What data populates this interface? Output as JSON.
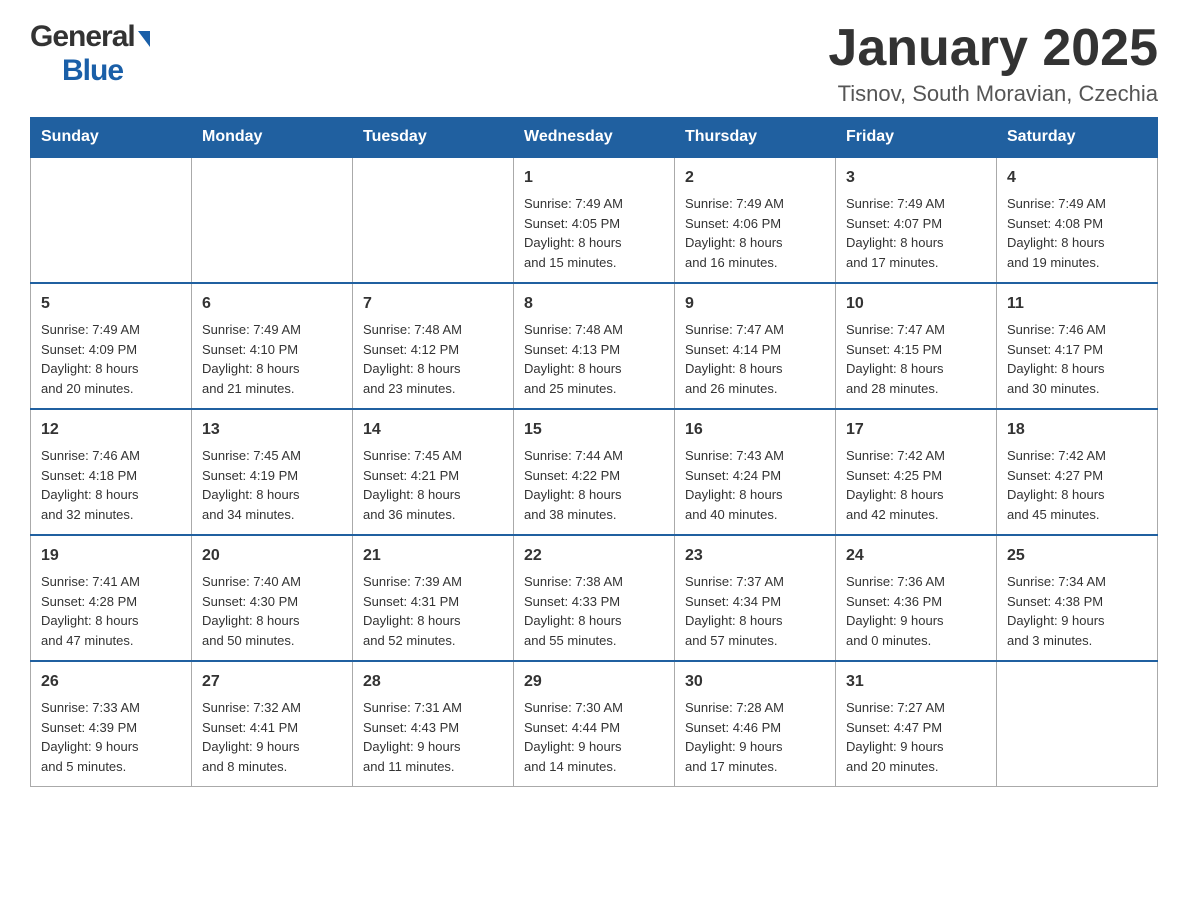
{
  "header": {
    "logo_general": "General",
    "logo_blue": "Blue",
    "title": "January 2025",
    "location": "Tisnov, South Moravian, Czechia"
  },
  "days_of_week": [
    "Sunday",
    "Monday",
    "Tuesday",
    "Wednesday",
    "Thursday",
    "Friday",
    "Saturday"
  ],
  "weeks": [
    [
      {
        "day": "",
        "info": ""
      },
      {
        "day": "",
        "info": ""
      },
      {
        "day": "",
        "info": ""
      },
      {
        "day": "1",
        "info": "Sunrise: 7:49 AM\nSunset: 4:05 PM\nDaylight: 8 hours\nand 15 minutes."
      },
      {
        "day": "2",
        "info": "Sunrise: 7:49 AM\nSunset: 4:06 PM\nDaylight: 8 hours\nand 16 minutes."
      },
      {
        "day": "3",
        "info": "Sunrise: 7:49 AM\nSunset: 4:07 PM\nDaylight: 8 hours\nand 17 minutes."
      },
      {
        "day": "4",
        "info": "Sunrise: 7:49 AM\nSunset: 4:08 PM\nDaylight: 8 hours\nand 19 minutes."
      }
    ],
    [
      {
        "day": "5",
        "info": "Sunrise: 7:49 AM\nSunset: 4:09 PM\nDaylight: 8 hours\nand 20 minutes."
      },
      {
        "day": "6",
        "info": "Sunrise: 7:49 AM\nSunset: 4:10 PM\nDaylight: 8 hours\nand 21 minutes."
      },
      {
        "day": "7",
        "info": "Sunrise: 7:48 AM\nSunset: 4:12 PM\nDaylight: 8 hours\nand 23 minutes."
      },
      {
        "day": "8",
        "info": "Sunrise: 7:48 AM\nSunset: 4:13 PM\nDaylight: 8 hours\nand 25 minutes."
      },
      {
        "day": "9",
        "info": "Sunrise: 7:47 AM\nSunset: 4:14 PM\nDaylight: 8 hours\nand 26 minutes."
      },
      {
        "day": "10",
        "info": "Sunrise: 7:47 AM\nSunset: 4:15 PM\nDaylight: 8 hours\nand 28 minutes."
      },
      {
        "day": "11",
        "info": "Sunrise: 7:46 AM\nSunset: 4:17 PM\nDaylight: 8 hours\nand 30 minutes."
      }
    ],
    [
      {
        "day": "12",
        "info": "Sunrise: 7:46 AM\nSunset: 4:18 PM\nDaylight: 8 hours\nand 32 minutes."
      },
      {
        "day": "13",
        "info": "Sunrise: 7:45 AM\nSunset: 4:19 PM\nDaylight: 8 hours\nand 34 minutes."
      },
      {
        "day": "14",
        "info": "Sunrise: 7:45 AM\nSunset: 4:21 PM\nDaylight: 8 hours\nand 36 minutes."
      },
      {
        "day": "15",
        "info": "Sunrise: 7:44 AM\nSunset: 4:22 PM\nDaylight: 8 hours\nand 38 minutes."
      },
      {
        "day": "16",
        "info": "Sunrise: 7:43 AM\nSunset: 4:24 PM\nDaylight: 8 hours\nand 40 minutes."
      },
      {
        "day": "17",
        "info": "Sunrise: 7:42 AM\nSunset: 4:25 PM\nDaylight: 8 hours\nand 42 minutes."
      },
      {
        "day": "18",
        "info": "Sunrise: 7:42 AM\nSunset: 4:27 PM\nDaylight: 8 hours\nand 45 minutes."
      }
    ],
    [
      {
        "day": "19",
        "info": "Sunrise: 7:41 AM\nSunset: 4:28 PM\nDaylight: 8 hours\nand 47 minutes."
      },
      {
        "day": "20",
        "info": "Sunrise: 7:40 AM\nSunset: 4:30 PM\nDaylight: 8 hours\nand 50 minutes."
      },
      {
        "day": "21",
        "info": "Sunrise: 7:39 AM\nSunset: 4:31 PM\nDaylight: 8 hours\nand 52 minutes."
      },
      {
        "day": "22",
        "info": "Sunrise: 7:38 AM\nSunset: 4:33 PM\nDaylight: 8 hours\nand 55 minutes."
      },
      {
        "day": "23",
        "info": "Sunrise: 7:37 AM\nSunset: 4:34 PM\nDaylight: 8 hours\nand 57 minutes."
      },
      {
        "day": "24",
        "info": "Sunrise: 7:36 AM\nSunset: 4:36 PM\nDaylight: 9 hours\nand 0 minutes."
      },
      {
        "day": "25",
        "info": "Sunrise: 7:34 AM\nSunset: 4:38 PM\nDaylight: 9 hours\nand 3 minutes."
      }
    ],
    [
      {
        "day": "26",
        "info": "Sunrise: 7:33 AM\nSunset: 4:39 PM\nDaylight: 9 hours\nand 5 minutes."
      },
      {
        "day": "27",
        "info": "Sunrise: 7:32 AM\nSunset: 4:41 PM\nDaylight: 9 hours\nand 8 minutes."
      },
      {
        "day": "28",
        "info": "Sunrise: 7:31 AM\nSunset: 4:43 PM\nDaylight: 9 hours\nand 11 minutes."
      },
      {
        "day": "29",
        "info": "Sunrise: 7:30 AM\nSunset: 4:44 PM\nDaylight: 9 hours\nand 14 minutes."
      },
      {
        "day": "30",
        "info": "Sunrise: 7:28 AM\nSunset: 4:46 PM\nDaylight: 9 hours\nand 17 minutes."
      },
      {
        "day": "31",
        "info": "Sunrise: 7:27 AM\nSunset: 4:47 PM\nDaylight: 9 hours\nand 20 minutes."
      },
      {
        "day": "",
        "info": ""
      }
    ]
  ]
}
